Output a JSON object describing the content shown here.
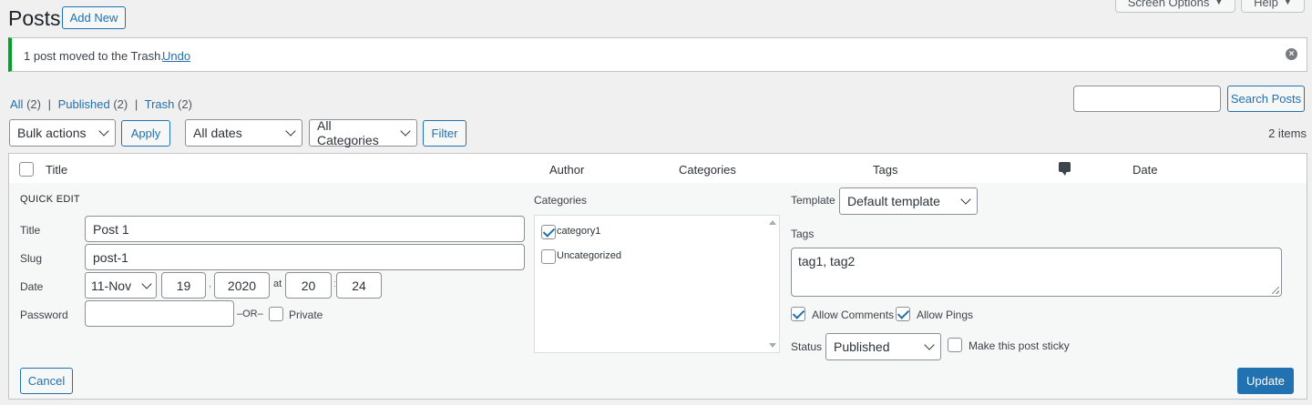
{
  "header": {
    "title": "Posts",
    "add_new": "Add New",
    "screen_options": "Screen Options",
    "help": "Help"
  },
  "notice": {
    "message": "1 post moved to the Trash.",
    "undo": "Undo"
  },
  "views": {
    "all": "All",
    "all_count": "(2)",
    "published": "Published",
    "published_count": "(2)",
    "trash": "Trash",
    "trash_count": "(2)",
    "sep": "|"
  },
  "search": {
    "value": "",
    "button": "Search Posts"
  },
  "filters": {
    "bulk": "Bulk actions",
    "apply": "Apply",
    "dates": "All dates",
    "categories": "All Categories",
    "filter": "Filter",
    "count": "2 items"
  },
  "table": {
    "title": "Title",
    "author": "Author",
    "categories": "Categories",
    "tags": "Tags",
    "date": "Date"
  },
  "quick_edit": {
    "heading": "QUICK EDIT",
    "title_label": "Title",
    "title_value": "Post 1",
    "slug_label": "Slug",
    "slug_value": "post-1",
    "date_label": "Date",
    "month": "11-Nov",
    "day": "19",
    "comma": ",",
    "year": "2020",
    "at": "at",
    "hour": "20",
    "colon": ":",
    "minute": "24",
    "password_label": "Password",
    "password_value": "",
    "or": "–OR–",
    "private": "Private",
    "categories_label": "Categories",
    "cat1": "category1",
    "cat2": "Uncategorized",
    "template_label": "Template",
    "template_value": "Default template",
    "tags_label": "Tags",
    "tags_value": "tag1, tag2",
    "allow_comments": "Allow Comments",
    "allow_pings": "Allow Pings",
    "status_label": "Status",
    "status_value": "Published",
    "sticky": "Make this post sticky",
    "cancel": "Cancel",
    "update": "Update"
  },
  "colors": {
    "accent": "#2271b1",
    "success": "#00a32a"
  }
}
